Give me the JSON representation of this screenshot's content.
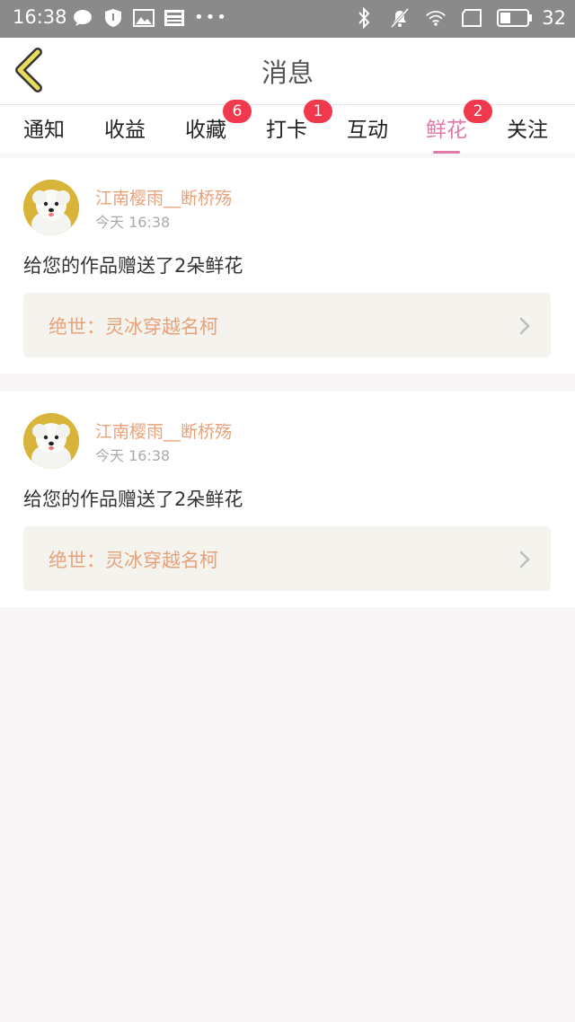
{
  "status_bar": {
    "time": "16:38",
    "battery": "32",
    "icons": [
      "chat-bubble-icon",
      "shield-icon",
      "image-icon",
      "news-icon",
      "more-dots-icon",
      "bluetooth-icon",
      "mute-icon",
      "wifi-icon",
      "tablet-icon",
      "battery-icon"
    ]
  },
  "header": {
    "title": "消息",
    "back_icon": "chevron-left-icon",
    "accent_color": "#d9c84a"
  },
  "tabs": [
    {
      "label": "通知",
      "badge": null,
      "active": false
    },
    {
      "label": "收益",
      "badge": null,
      "active": false
    },
    {
      "label": "收藏",
      "badge": "6",
      "active": false
    },
    {
      "label": "打卡",
      "badge": "1",
      "active": false
    },
    {
      "label": "互动",
      "badge": null,
      "active": false
    },
    {
      "label": "鲜花",
      "badge": "2",
      "active": true
    },
    {
      "label": "关注",
      "badge": null,
      "active": false
    }
  ],
  "colors": {
    "active_tab": "#e07aa9",
    "badge": "#f0394c",
    "username": "#e8a27a",
    "work_title": "#e8a27a"
  },
  "messages": [
    {
      "username": "江南樱雨__断桥殇",
      "timestamp": "今天  16:38",
      "text": "给您的作品赠送了2朵鲜花",
      "work": "绝世：灵冰穿越名柯"
    },
    {
      "username": "江南樱雨__断桥殇",
      "timestamp": "今天  16:38",
      "text": "给您的作品赠送了2朵鲜花",
      "work": "绝世：灵冰穿越名柯"
    }
  ]
}
